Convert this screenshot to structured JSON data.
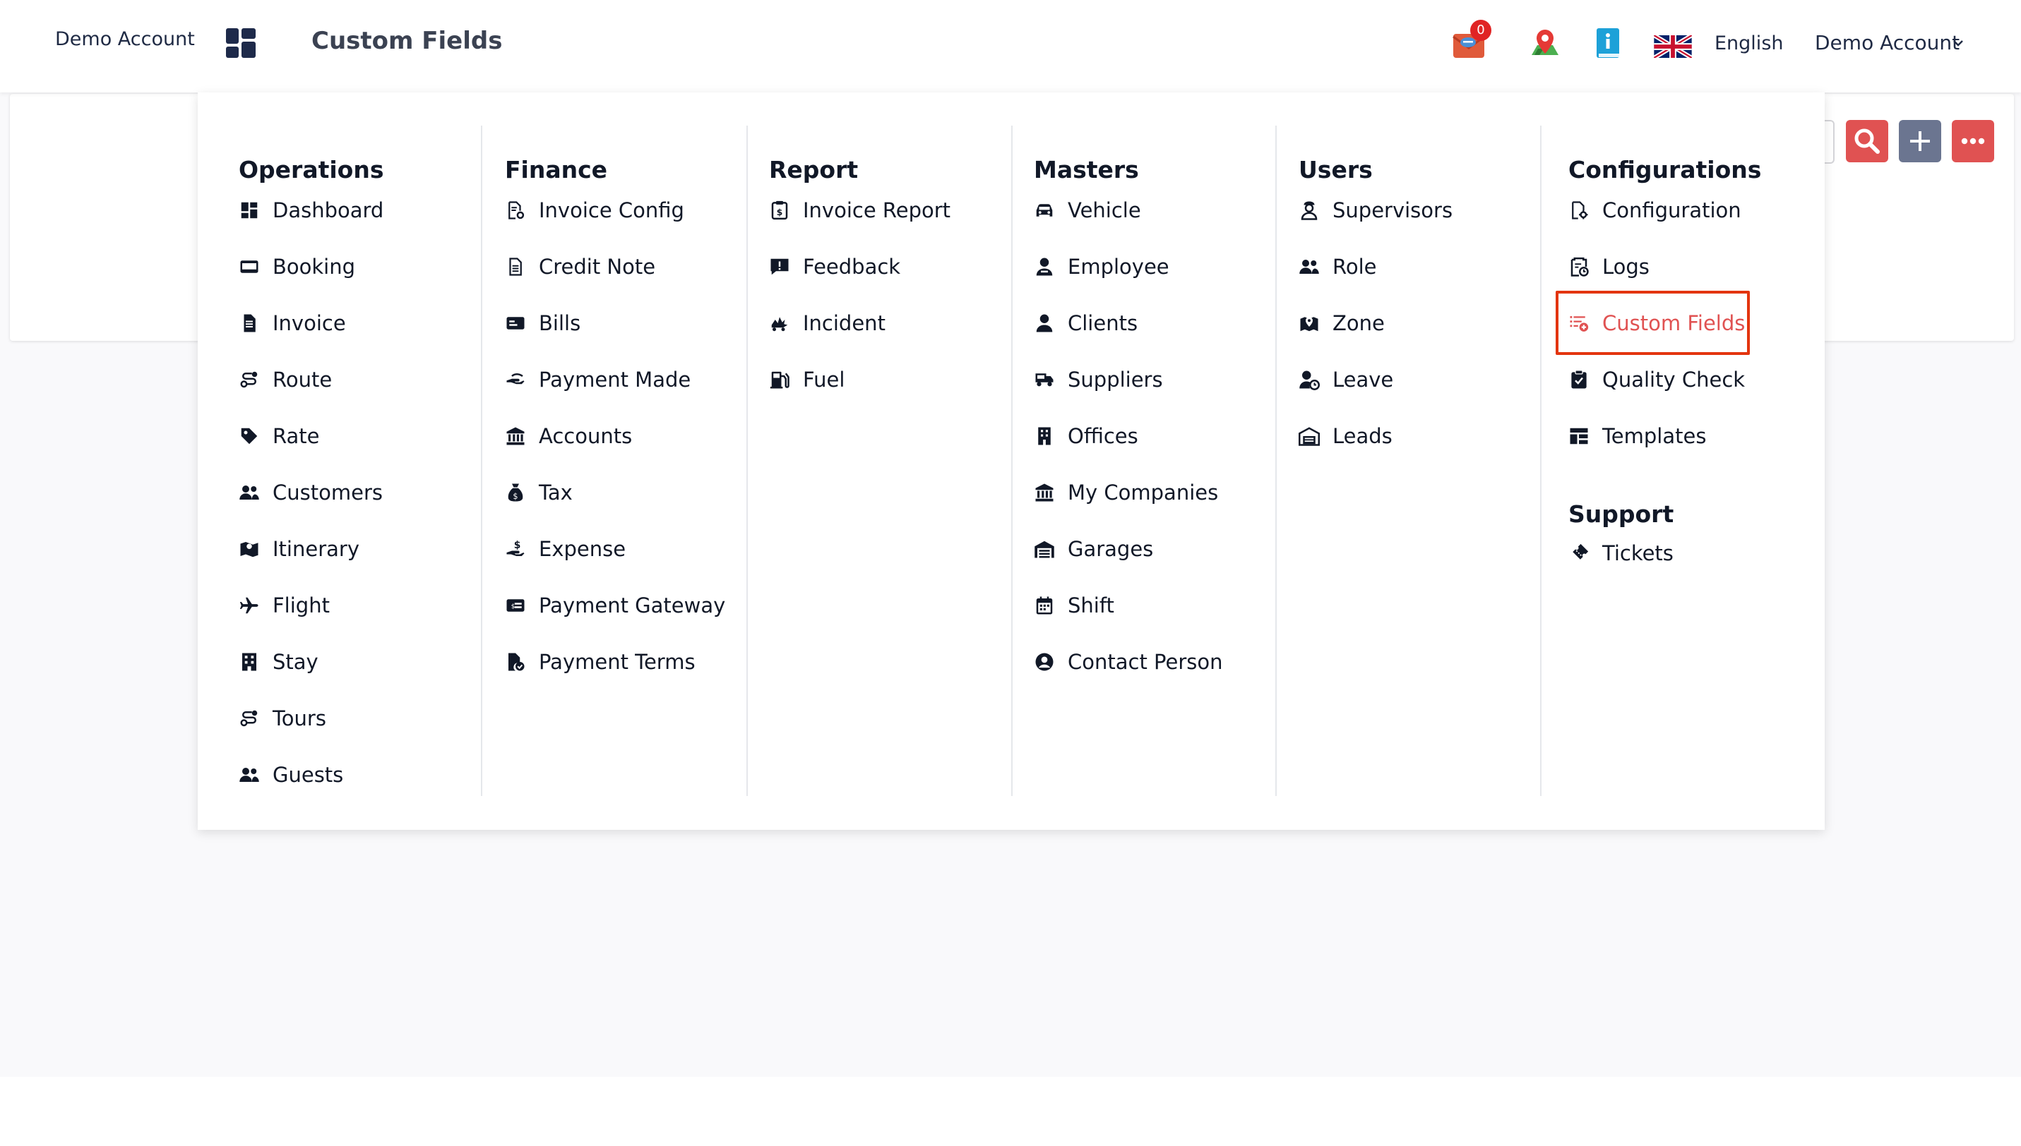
{
  "header": {
    "account_label": "Demo Account",
    "page_title": "Custom Fields",
    "notification_count": "0",
    "language": "English",
    "user_menu": "Demo Account"
  },
  "colors": {
    "accent": "#e05252",
    "highlight_border": "#e3350f",
    "navy": "#1e2a4a",
    "plus_button": "#6b7590",
    "search_button": "#e05252"
  },
  "menu": {
    "operations": {
      "title": "Operations",
      "items": [
        "Dashboard",
        "Booking",
        "Invoice",
        "Route",
        "Rate",
        "Customers",
        "Itinerary",
        "Flight",
        "Stay",
        "Tours",
        "Guests"
      ],
      "icons": [
        "dashboard-icon",
        "booking-icon",
        "invoice-icon",
        "route-icon",
        "tag-icon",
        "customers-icon",
        "map-icon",
        "plane-icon",
        "building-icon",
        "route-icon",
        "guests-icon"
      ]
    },
    "finance": {
      "title": "Finance",
      "items": [
        "Invoice Config",
        "Credit Note",
        "Bills",
        "Payment Made",
        "Accounts",
        "Tax",
        "Expense",
        "Payment Gateway",
        "Payment Terms"
      ],
      "icons": [
        "file-gear-icon",
        "file-icon",
        "money-bill-icon",
        "hand-money-icon",
        "bank-icon",
        "money-bag-icon",
        "hand-dollar-icon",
        "payment-icon",
        "file-check-icon"
      ]
    },
    "report": {
      "title": "Report",
      "items": [
        "Invoice Report",
        "Feedback",
        "Incident",
        "Fuel"
      ],
      "icons": [
        "clipboard-dollar-icon",
        "comment-alert-icon",
        "car-crash-icon",
        "gas-pump-icon"
      ]
    },
    "masters": {
      "title": "Masters",
      "items": [
        "Vehicle",
        "Employee",
        "Clients",
        "Suppliers",
        "Offices",
        "My Companies",
        "Garages",
        "Shift",
        "Contact Person"
      ],
      "icons": [
        "car-icon",
        "employee-icon",
        "client-icon",
        "truck-icon",
        "office-building-icon",
        "bank-icon",
        "garage-icon",
        "calendar-icon",
        "user-circle-icon"
      ]
    },
    "users": {
      "title": "Users",
      "items": [
        "Supervisors",
        "Role",
        "Zone",
        "Leave",
        "Leads"
      ],
      "icons": [
        "supervisor-icon",
        "users-icon",
        "map-pin-icon",
        "user-clock-icon",
        "warehouse-icon"
      ]
    },
    "configurations": {
      "title": "Configurations",
      "items": [
        "Configuration",
        "Logs",
        "Custom Fields",
        "Quality Check",
        "Templates"
      ],
      "icons": [
        "file-settings-icon",
        "clipboard-clock-icon",
        "list-add-icon",
        "clipboard-check-icon",
        "layout-icon"
      ]
    },
    "support": {
      "title": "Support",
      "items": [
        "Tickets"
      ],
      "icons": [
        "ticket-icon"
      ]
    }
  }
}
